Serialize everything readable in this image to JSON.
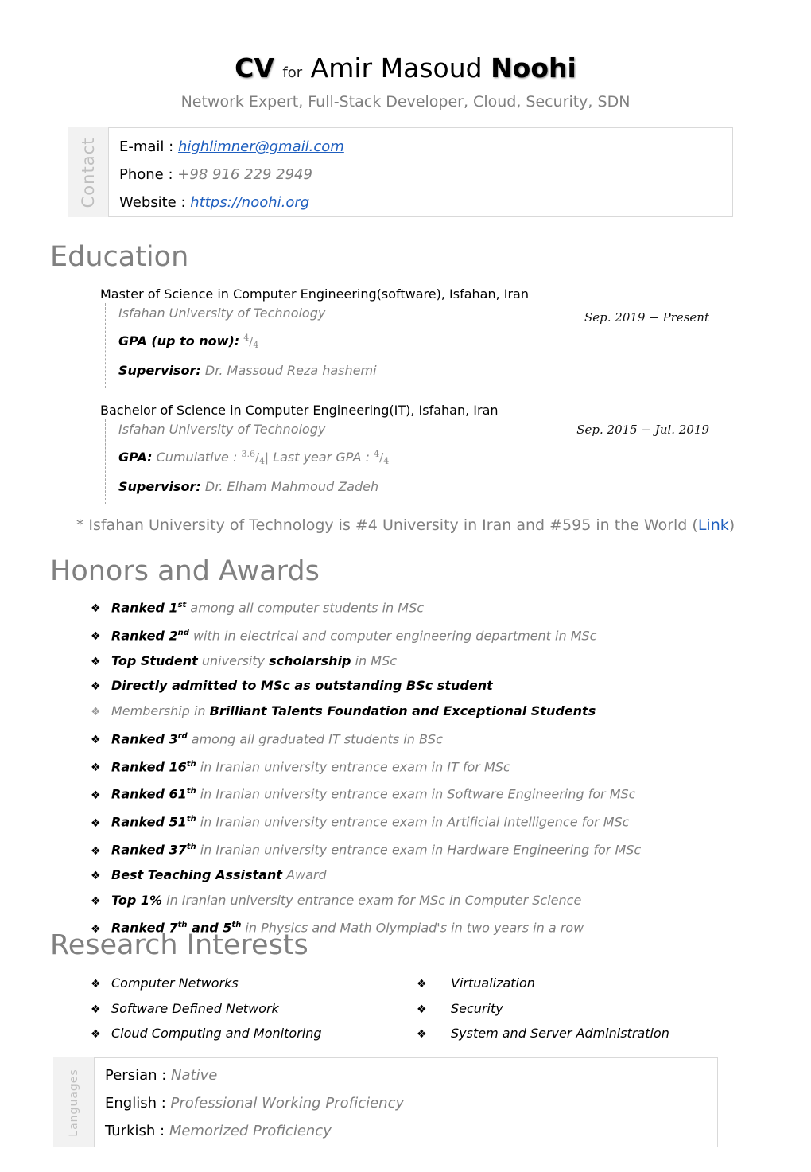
{
  "header": {
    "cv": "CV",
    "for": "for",
    "first_names": "Amir Masoud",
    "last_name": "Noohi",
    "subtitle": "Network Expert, Full-Stack Developer, Cloud, Security, SDN"
  },
  "contact": {
    "label": "Contact",
    "email_key": "E-mail :",
    "email": "highlimner@gmail.com",
    "phone_key": "Phone :",
    "phone": "+98 916 229 2949",
    "website_key": "Website :",
    "website": "https://noohi.org"
  },
  "education": {
    "heading": "Education",
    "degrees": [
      {
        "title": "Master of Science in Computer Engineering(software), Isfahan, Iran",
        "university": "Isfahan University of Technology",
        "date": "Sep. 2019  − Present",
        "gpa_label": "GPA (up to now):",
        "gpa_num": "4",
        "gpa_den": "4",
        "supervisor_label": "Supervisor:",
        "supervisor": "Dr. Massoud Reza hashemi"
      },
      {
        "title": "Bachelor of Science in Computer Engineering(IT), Isfahan, Iran",
        "university": "Isfahan University of Technology",
        "date": "Sep. 2015  − Jul. 2019",
        "gpa_label": "GPA:",
        "cumulative_label": "Cumulative :",
        "gpa_num": "3.6",
        "gpa_den": "4",
        "sep": "|",
        "last_year_label": "Last year GPA :",
        "last_num": "4",
        "last_den": "4",
        "supervisor_label": "Supervisor:",
        "supervisor": "Dr. Elham Mahmoud Zadeh"
      }
    ],
    "note_prefix": "* Isfahan University of Technology is #4 University in Iran and #595 in the World (",
    "note_link": "Link",
    "note_suffix": ")"
  },
  "honors": {
    "heading": "Honors and Awards",
    "bullet": "❖",
    "items": [
      {
        "b1": "Ranked 1",
        "sup": "st",
        "b2": "",
        "rest": " among all computer students in MSc"
      },
      {
        "b1": "Ranked 2",
        "sup": "nd",
        "b2": "",
        "rest": " with in electrical and computer engineering department in MSc"
      },
      {
        "b1": "Top Student",
        "g1": " university ",
        "b2": "scholarship",
        "rest": " in MSc"
      },
      {
        "b1": "Directly admitted to MSc as outstanding BSc student"
      },
      {
        "g0": "Membership in ",
        "b1": "Brilliant Talents Foundation and Exceptional Students"
      },
      {
        "b1": "Ranked 3",
        "sup": "rd",
        "rest": " among all graduated IT students in BSc"
      },
      {
        "b1": "Ranked 16",
        "sup": "th",
        "rest": " in Iranian university entrance exam in IT for MSc"
      },
      {
        "b1": "Ranked 61",
        "sup": "th",
        "rest": " in Iranian university entrance exam in Software Engineering for MSc"
      },
      {
        "b1": "Ranked 51",
        "sup": "th",
        "rest": " in Iranian university entrance exam in Artificial Intelligence for MSc"
      },
      {
        "b1": "Ranked 37",
        "sup": "th",
        "rest": " in Iranian university entrance exam in Hardware Engineering for MSc"
      },
      {
        "b1": "Best Teaching Assistant",
        "rest": " Award"
      },
      {
        "b1": "Top 1%",
        "rest": " in Iranian university entrance exam for MSc in Computer Science"
      },
      {
        "b1": "Ranked 7",
        "sup": "th",
        "b2": " and 5",
        "sup2": "th",
        "rest": " in Physics and Math Olympiad's in two years in a row"
      }
    ]
  },
  "research": {
    "heading": "Research Interests",
    "left": [
      "Computer Networks",
      "Software Defined Network",
      "Cloud Computing and Monitoring"
    ],
    "right": [
      "Virtualization",
      "Security",
      "System and Server Administration"
    ]
  },
  "languages": {
    "label": "Languages",
    "items": [
      {
        "key": "Persian :",
        "val": "Native"
      },
      {
        "key": "English :",
        "val": "Professional Working Proficiency"
      },
      {
        "key": "Turkish :",
        "val": "Memorized Proficiency"
      }
    ]
  }
}
